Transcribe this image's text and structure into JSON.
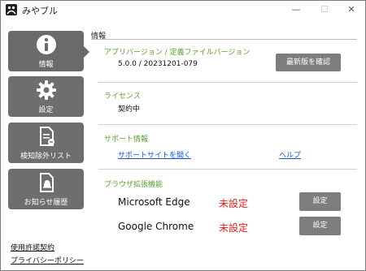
{
  "window": {
    "title": "みやブル"
  },
  "sidebar": {
    "items": [
      {
        "label": "情報",
        "icon": "info-icon"
      },
      {
        "label": "設定",
        "icon": "gear-icon"
      },
      {
        "label": "検知除外リスト",
        "icon": "document-list-icon"
      },
      {
        "label": "お知らせ履歴",
        "icon": "bell-document-icon"
      }
    ],
    "footer_links": [
      "使用許諾契約",
      "プライバシーポリシー"
    ]
  },
  "main": {
    "heading": "情報",
    "version_section": {
      "title": "アプリバージョン / 定義ファイルバージョン",
      "value": "5.0.0 / 20231201-079",
      "button": "最新版を確認"
    },
    "license_section": {
      "title": "ライセンス",
      "value": "契約中"
    },
    "support_section": {
      "title": "サポート情報",
      "link_support": "サポートサイトを開く",
      "link_help": "ヘルプ"
    },
    "extensions_section": {
      "title": "ブラウザ拡張機能",
      "items": [
        {
          "name": "Microsoft Edge",
          "status": "未設定",
          "button": "設定"
        },
        {
          "name": "Google Chrome",
          "status": "未設定",
          "button": "設定"
        }
      ]
    }
  },
  "colors": {
    "nav_bg": "#6e6e6e",
    "section_title": "#5aa02c",
    "link": "#1a56d6",
    "status_warn": "#e01e1e",
    "button_bg": "#7d7d7d"
  }
}
